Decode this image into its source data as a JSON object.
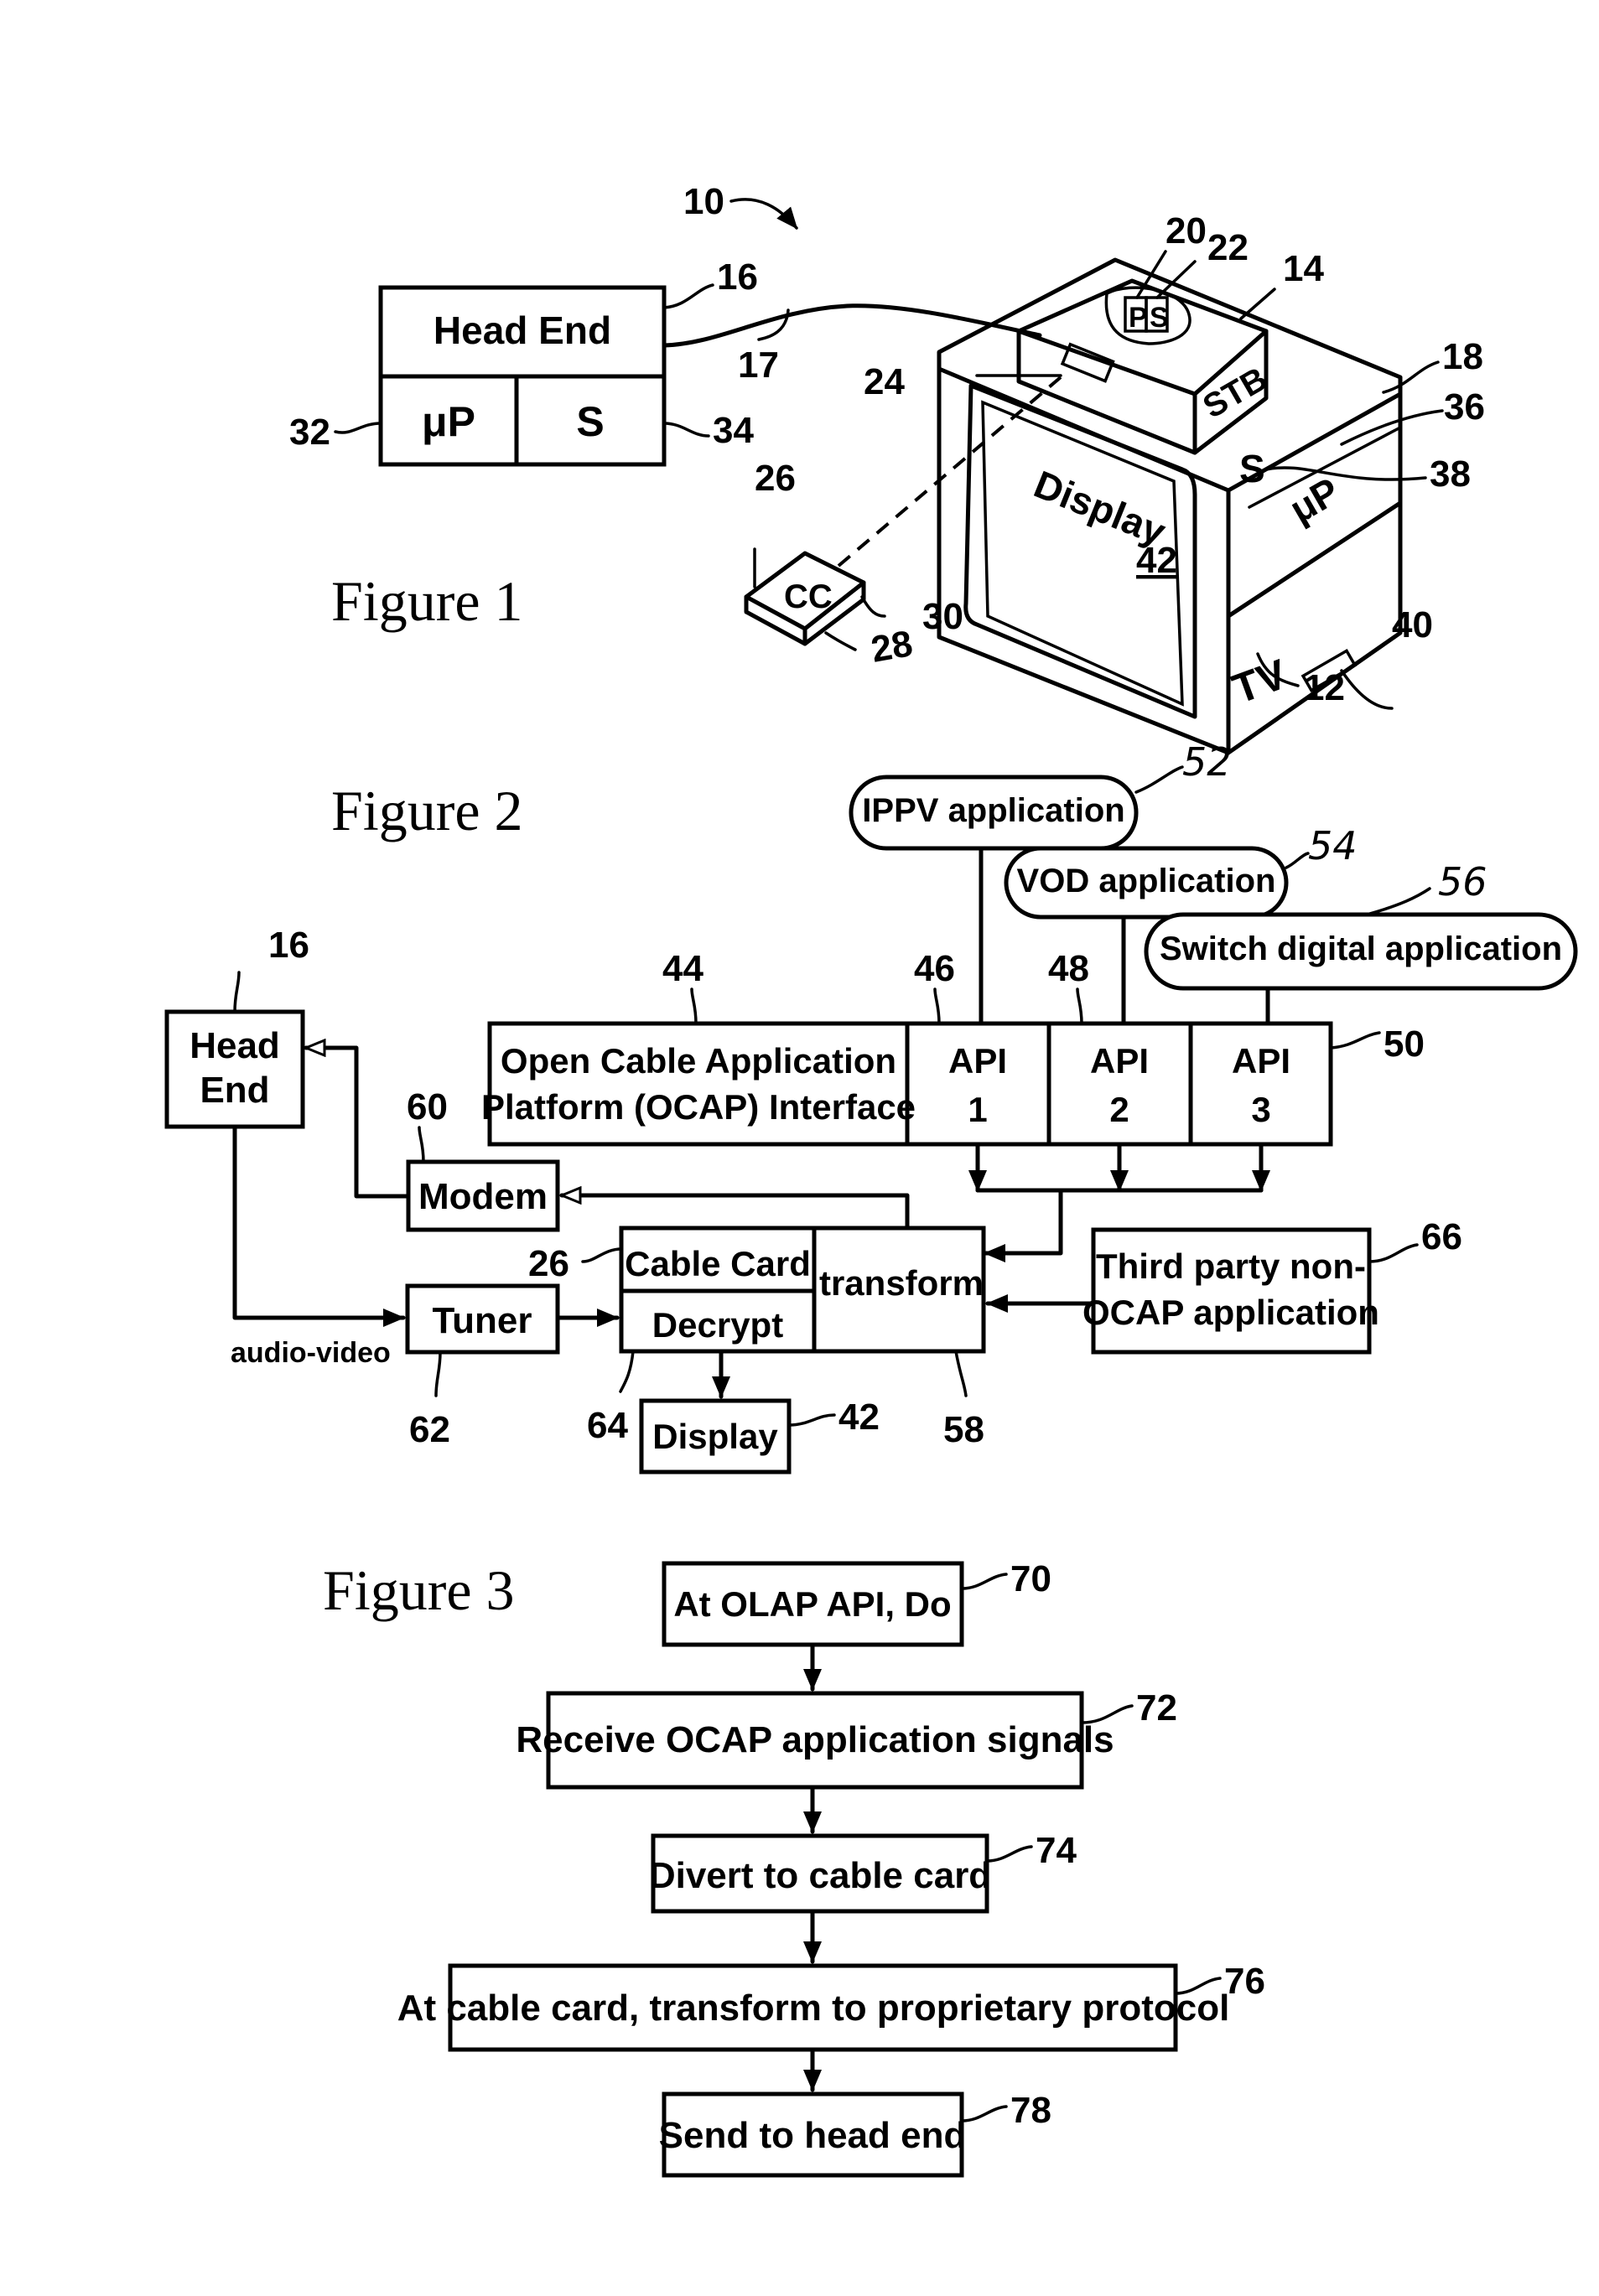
{
  "figure1": {
    "caption": "Figure 1",
    "system_ref": "10",
    "head_end": {
      "title": "Head End",
      "ref": "16",
      "processor": "μP",
      "processor_ref": "32",
      "storage": "S",
      "storage_ref": "34"
    },
    "link_ref": "17",
    "stb": {
      "label": "STB",
      "ref": "14",
      "p_label": "P",
      "p_ref": "20",
      "s_label": "S",
      "s_ref": "22",
      "slot_ref": "24"
    },
    "tv": {
      "label": "TV",
      "ref": "12",
      "housing_ref": "18",
      "processor": "μP",
      "processor_ref": "36",
      "storage": "S",
      "storage_ref": "38",
      "slot_ref": "40"
    },
    "display": {
      "label": "Display",
      "ref": "42"
    },
    "cable_card": {
      "label": "CC",
      "ref": "26",
      "ref_b": "28",
      "ref_c": "30"
    }
  },
  "figure2": {
    "caption": "Figure 2",
    "head_end": {
      "line1": "Head",
      "line2": "End",
      "ref": "16"
    },
    "ocap": {
      "line1": "Open Cable Application",
      "line2": "Platform (OCAP) Interface",
      "ref": "44"
    },
    "apis": [
      {
        "line1": "API",
        "line2": "1",
        "ref": "46"
      },
      {
        "line1": "API",
        "line2": "2",
        "ref": "48"
      },
      {
        "line1": "API",
        "line2": "3",
        "ref": "50"
      }
    ],
    "apps": [
      {
        "label": "IPPV application",
        "ref": "52"
      },
      {
        "label": "VOD application",
        "ref": "54"
      },
      {
        "label": "Switch digital application",
        "ref": "56"
      }
    ],
    "modem": {
      "label": "Modem",
      "ref": "60"
    },
    "tuner": {
      "label": "Tuner",
      "ref": "62"
    },
    "audio_video": "audio-video",
    "cable_card": {
      "label": "Cable Card",
      "ref": "26"
    },
    "decrypt": {
      "label": "Decrypt",
      "ref": "64"
    },
    "transform": {
      "label": "transform",
      "ref": "58"
    },
    "third_party": {
      "line1": "Third party non-",
      "line2": "OCAP application",
      "ref": "66"
    },
    "display": {
      "label": "Display",
      "ref": "42"
    }
  },
  "figure3": {
    "caption": "Figure 3",
    "steps": [
      {
        "label": "At OLAP API, Do",
        "ref": "70"
      },
      {
        "label": "Receive OCAP application signals",
        "ref": "72"
      },
      {
        "label": "Divert to cable card",
        "ref": "74"
      },
      {
        "label": "At cable card, transform to proprietary protocol",
        "ref": "76"
      },
      {
        "label": "Send to head end",
        "ref": "78"
      }
    ]
  }
}
